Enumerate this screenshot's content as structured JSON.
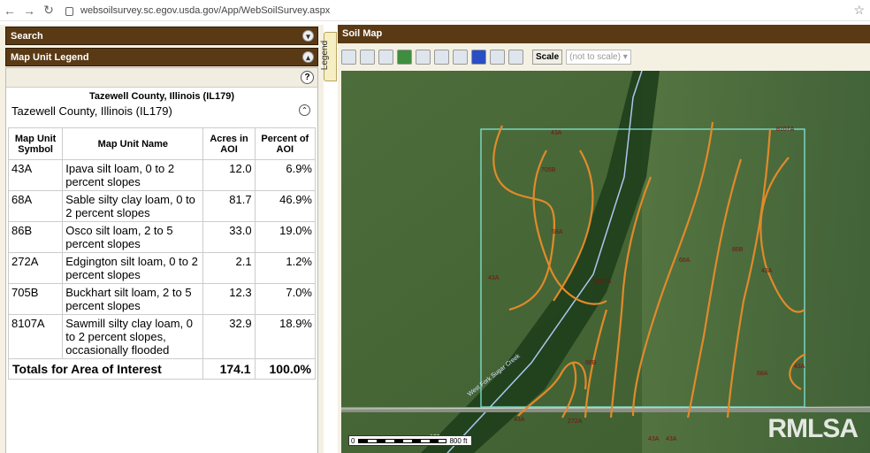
{
  "browser": {
    "url": "websoilsurvey.sc.egov.usda.gov/App/WebSoilSurvey.aspx"
  },
  "panels": {
    "search": "Search",
    "legend": "Map Unit Legend",
    "legend_tab": "Legend",
    "map": "Soil Map"
  },
  "legend": {
    "county_title": "Tazewell County, Illinois (IL179)",
    "county_sub": "Tazewell County, Illinois (IL179)",
    "columns": [
      "Map Unit Symbol",
      "Map Unit Name",
      "Acres in AOI",
      "Percent of AOI"
    ],
    "rows": [
      {
        "symbol": "43A",
        "name": "Ipava silt loam, 0 to 2 percent slopes",
        "acres": "12.0",
        "percent": "6.9%"
      },
      {
        "symbol": "68A",
        "name": "Sable silty clay loam, 0 to 2 percent slopes",
        "acres": "81.7",
        "percent": "46.9%"
      },
      {
        "symbol": "86B",
        "name": "Osco silt loam, 2 to 5 percent slopes",
        "acres": "33.0",
        "percent": "19.0%"
      },
      {
        "symbol": "272A",
        "name": "Edgington silt loam, 0 to 2 percent slopes",
        "acres": "2.1",
        "percent": "1.2%"
      },
      {
        "symbol": "705B",
        "name": "Buckhart silt loam, 2 to 5 percent slopes",
        "acres": "12.3",
        "percent": "7.0%"
      },
      {
        "symbol": "8107A",
        "name": "Sawmill silty clay loam, 0 to 2 percent slopes, occasionally flooded",
        "acres": "32.9",
        "percent": "18.9%"
      }
    ],
    "total": {
      "label": "Totals for Area of Interest",
      "acres": "174.1",
      "percent": "100.0%"
    }
  },
  "toolbar": {
    "scale_label": "Scale",
    "scale_value": "(not to scale)"
  },
  "map": {
    "labels": [
      "43A",
      "705B",
      "68A",
      "43A",
      "8107A",
      "68A",
      "86B",
      "43A",
      "86B",
      "43A",
      "68A",
      "272A",
      "43A",
      "43A",
      "8107A",
      "43A",
      "122"
    ],
    "road_label": "West Fork Sugar Creek",
    "scalebar_text": "800 ft",
    "scalebar_zero": "0",
    "watermark": "RMLSA",
    "colors": {
      "soil_line": "#e08a2a",
      "aoi_border": "#7fe6d6",
      "creek": "#aac8ee"
    }
  }
}
